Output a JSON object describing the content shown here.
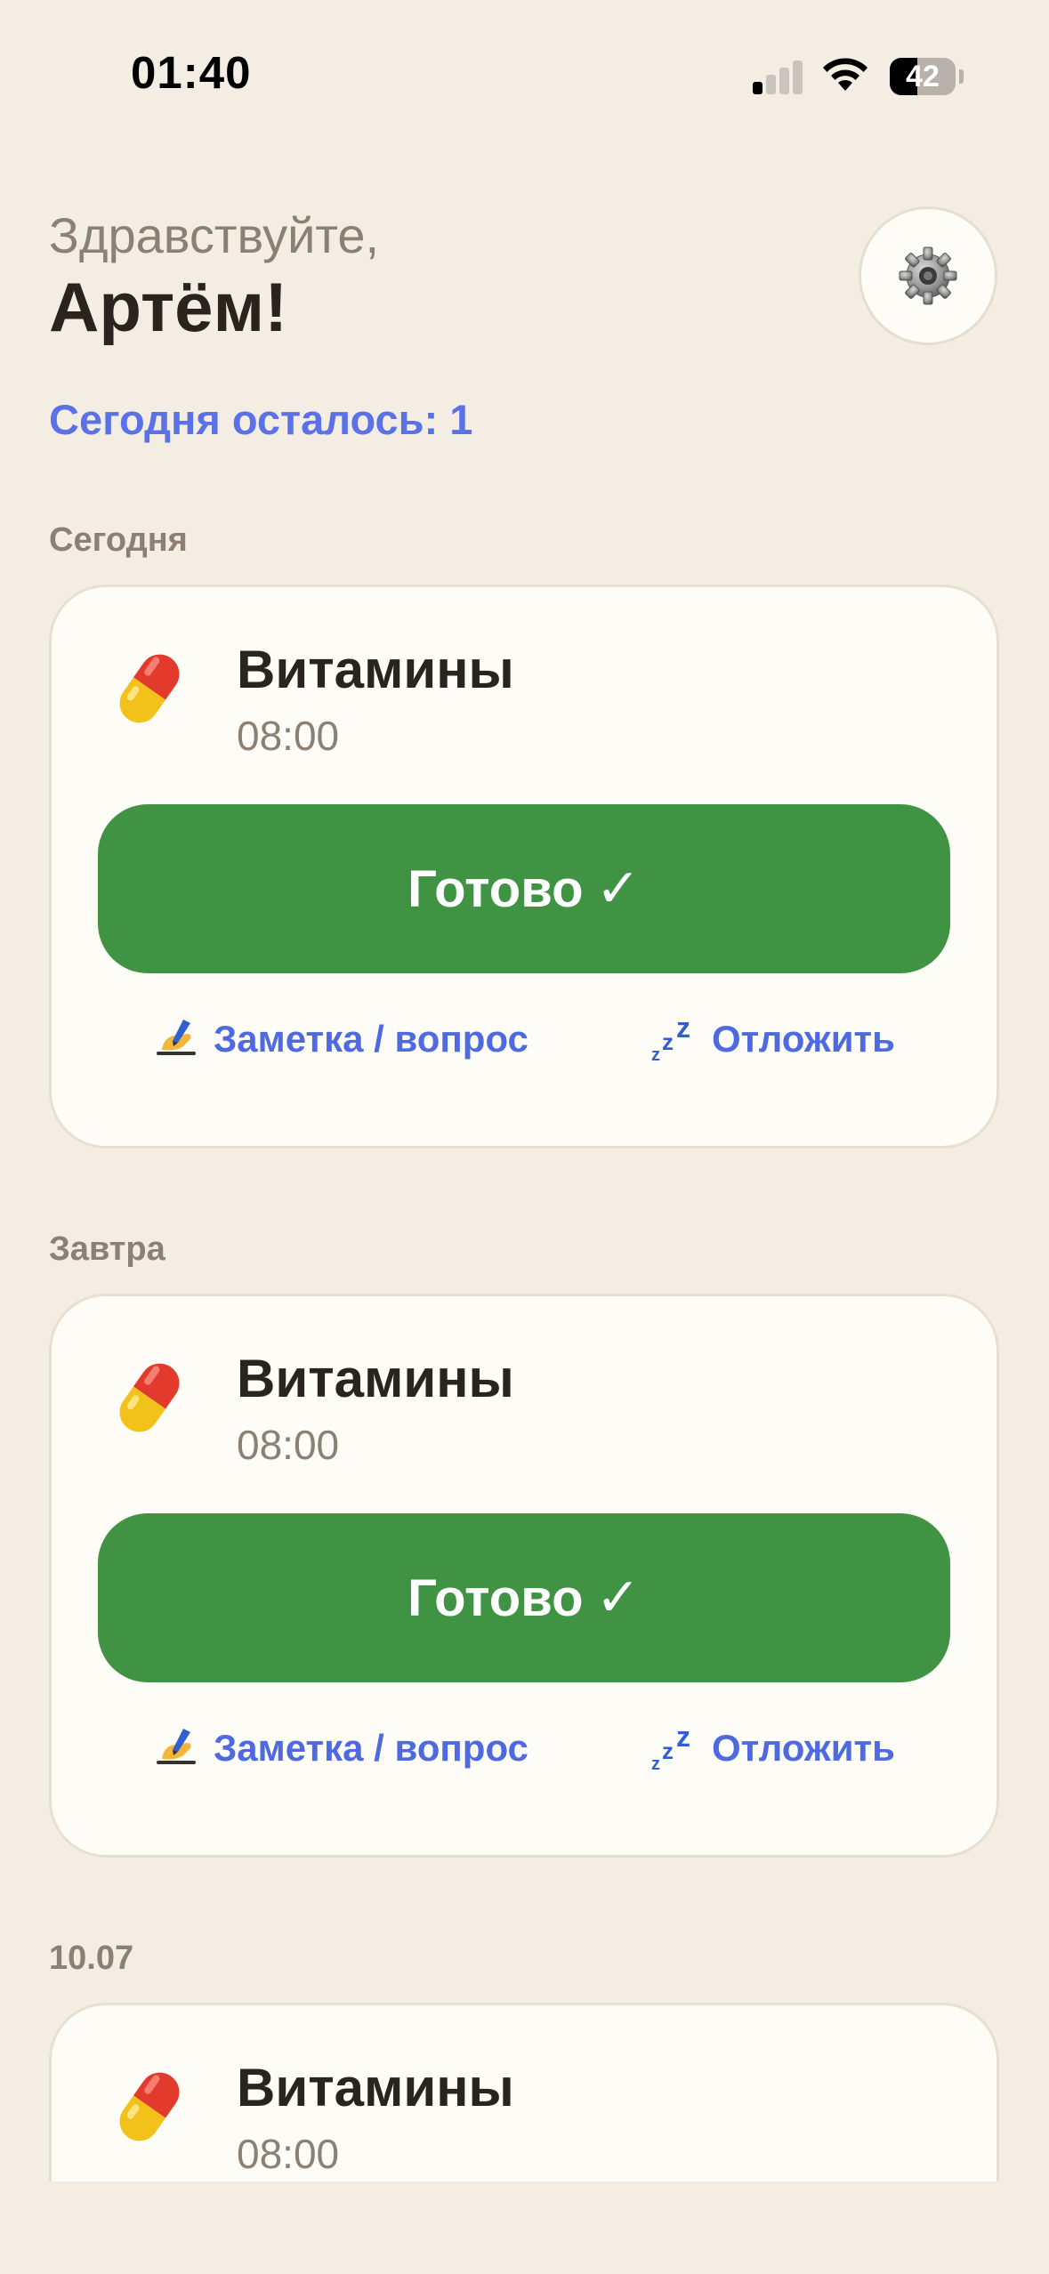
{
  "status_bar": {
    "time": "01:40",
    "battery": "42",
    "battery_level": 0.42
  },
  "header": {
    "greeting": "Здравствуйте,",
    "username": "Артём!",
    "settings_icon": "gear-icon"
  },
  "summary": {
    "remaining": "Сегодня осталось: 1"
  },
  "sections": [
    {
      "label": "Сегодня",
      "card": {
        "name": "Витамины",
        "time": "08:00",
        "icon": "pill-icon",
        "done_label": "Готово",
        "done_check": "✓",
        "note_label": "Заметка / вопрос",
        "snooze_label": "Отложить"
      }
    },
    {
      "label": "Завтра",
      "card": {
        "name": "Витамины",
        "time": "08:00",
        "icon": "pill-icon",
        "done_label": "Готово",
        "done_check": "✓",
        "note_label": "Заметка / вопрос",
        "snooze_label": "Отложить"
      }
    },
    {
      "label": "10.07",
      "card": {
        "name": "Витамины",
        "time": "08:00",
        "icon": "pill-icon"
      }
    }
  ],
  "colors": {
    "background": "#f3ede3",
    "card": "#fdfcf6",
    "accent": "#5a72e6",
    "done": "#3f9342",
    "muted": "#8b8073"
  }
}
